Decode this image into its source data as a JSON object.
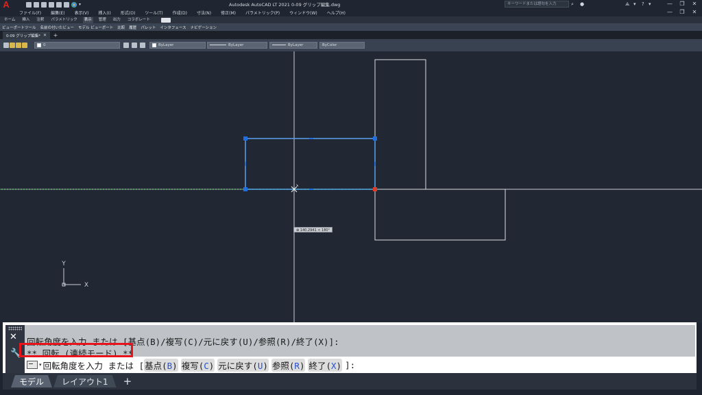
{
  "titlebar": {
    "app_title": "Autodesk AutoCAD LT 2021    0-09 グリップ編集.dwg",
    "search_placeholder": "キーワードまたは語句を入力",
    "app_logo": "A",
    "win_min": "—",
    "win_restore": "❐",
    "win_close": "✕"
  },
  "menu": {
    "items": [
      "ファイル(F)",
      "編集(E)",
      "表示(V)",
      "挿入(I)",
      "形式(O)",
      "ツール(T)",
      "作成(D)",
      "寸法(N)",
      "修正(M)",
      "パラメトリック(P)",
      "ウィンドウ(W)",
      "ヘルプ(H)"
    ]
  },
  "ribbon": {
    "tabs": [
      "ホーム",
      "挿入",
      "注釈",
      "パラメトリック",
      "表示",
      "管理",
      "出力",
      "コラボレート"
    ],
    "active_tab": "表示",
    "panels": [
      "ビューポートツール",
      "名前の付いたビュー",
      "モデル ビューポート",
      "比較",
      "履歴",
      "パレット",
      "インタフェース",
      "ナビゲーション"
    ]
  },
  "file_tab": {
    "name": "0-09 グリップ編集*",
    "close": "✕",
    "new": "+"
  },
  "properties": {
    "layer_value": "0",
    "color": "ByLayer",
    "linetype": "ByLayer",
    "lineweight": "ByLayer",
    "plotstyle": "ByColor"
  },
  "canvas": {
    "tooltip": "140.2941 < 180°",
    "ucs_x": "X",
    "ucs_y": "Y",
    "colors": {
      "background": "#212733",
      "selected": "#4a90e2",
      "grip": "#1f6fe0",
      "hot_grip": "#e03a2a"
    }
  },
  "command_line": {
    "history_1": "回転角度を入力 または [基点(B)/複写(C)/元に戻す(U)/参照(R)/終了(X)]:",
    "history_2": "** 回転 (連続モード) **",
    "prompt": "回転角度を入力 または [",
    "options": [
      {
        "label": "基点(",
        "key": "B",
        "close": ")"
      },
      {
        "label": "複写(",
        "key": "C",
        "close": ")"
      },
      {
        "label": "元に戻す(",
        "key": "U",
        "close": ")"
      },
      {
        "label": "参照(",
        "key": "R",
        "close": ")"
      },
      {
        "label": "終了(",
        "key": "X",
        "close": ")"
      }
    ],
    "suffix": "]:"
  },
  "layout_tabs": {
    "model": "モデル",
    "layout1": "レイアウト1",
    "add": "+"
  }
}
